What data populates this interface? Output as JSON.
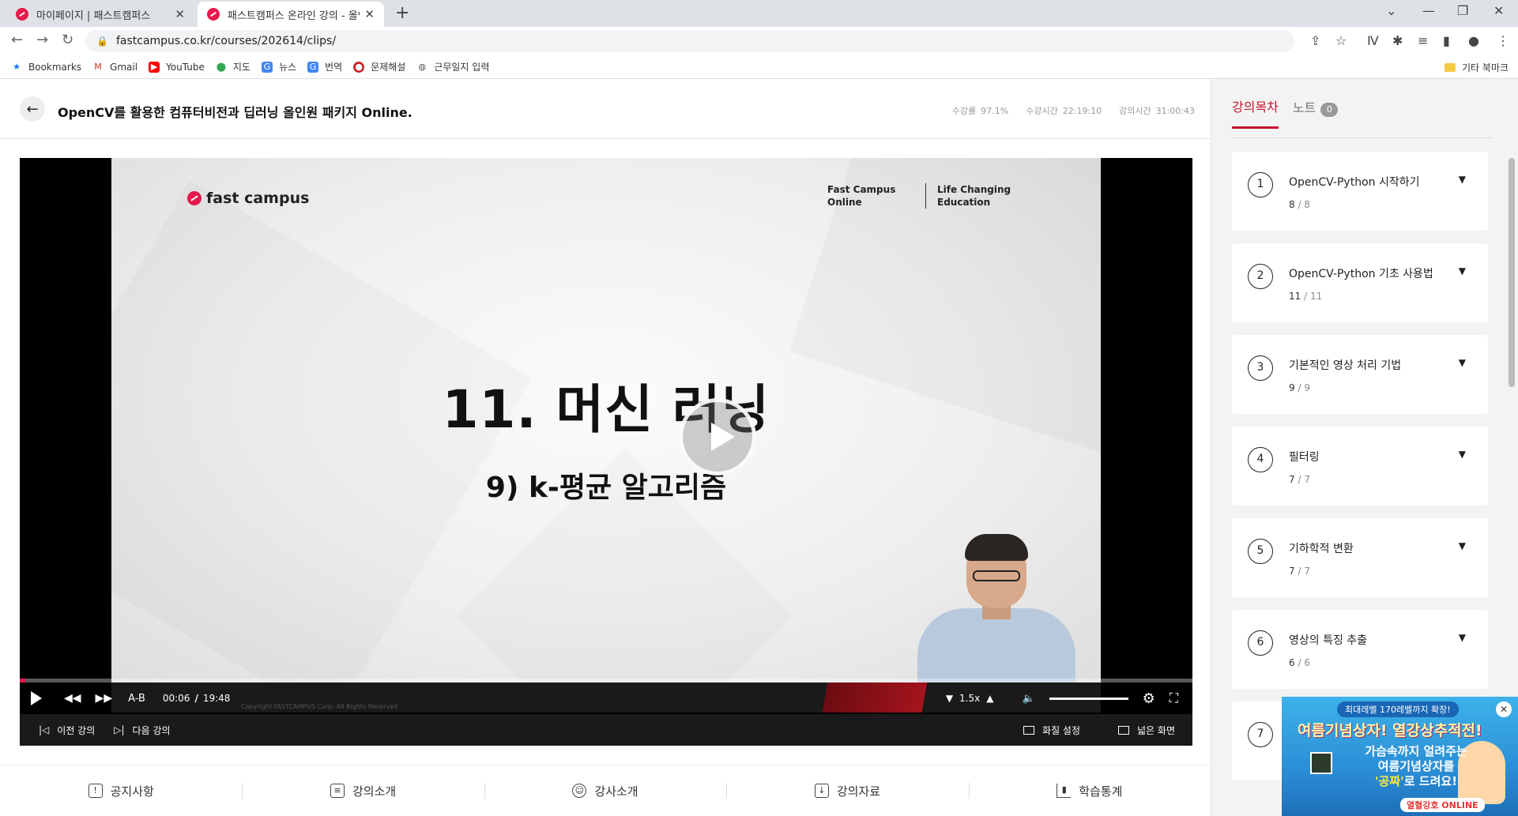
{
  "browser": {
    "tabs": [
      {
        "title": "마이페이지 | 패스트캠퍼스",
        "active": false
      },
      {
        "title": "패스트캠퍼스 온라인 강의 - 올인",
        "active": true
      }
    ],
    "url": "fastcampus.co.kr/courses/202614/clips/",
    "bookmarks": [
      {
        "label": "Bookmarks",
        "icon": "star-icon",
        "color": "#1a73e8"
      },
      {
        "label": "Gmail",
        "icon": "gmail-icon",
        "color": "#d93025"
      },
      {
        "label": "YouTube",
        "icon": "youtube-icon",
        "color": "#ff0000"
      },
      {
        "label": "지도",
        "icon": "maps-icon",
        "color": "#34a853"
      },
      {
        "label": "뉴스",
        "icon": "news-icon",
        "color": "#4285f4"
      },
      {
        "label": "번역",
        "icon": "translate-icon",
        "color": "#4285f4"
      },
      {
        "label": "문제해설",
        "icon": "bookmark-site-icon",
        "color": "#c62828"
      },
      {
        "label": "근무일지 입력",
        "icon": "globe-icon",
        "color": "#555555"
      }
    ],
    "other_bookmarks": "기타 북마크"
  },
  "course": {
    "title": "OpenCV를 활용한 컴퓨터비전과 딥러닝 올인원 패키지 Online.",
    "stats": [
      {
        "label": "수강률",
        "value": "97.1%"
      },
      {
        "label": "수강시간",
        "value": "22:19:10"
      },
      {
        "label": "강의시간",
        "value": "31:00:43"
      }
    ]
  },
  "video": {
    "slide": {
      "brand": "fast campus",
      "tag_a": [
        "Fast Campus",
        "Online"
      ],
      "tag_b": [
        "Life Changing",
        "Education"
      ],
      "title": "11. 머신 러닝",
      "subtitle": "9) k-평균 알고리즘",
      "copyright": "Copyright FASTCAMPUS Corp. All Rights Reserved"
    },
    "progress": 0.005,
    "ab_label": "A-B",
    "current_time": "00:06",
    "separator": "/",
    "duration": "19:48",
    "speed": "1.5x",
    "volume": 1.0,
    "prev_label": "이전 강의",
    "next_label": "다음 강의",
    "quality_label": "화질 설정",
    "wide_label": "넓은 화면"
  },
  "bottom_tabs": [
    {
      "label": "공지사항",
      "icon": "notice-icon"
    },
    {
      "label": "강의소개",
      "icon": "clipboard-icon"
    },
    {
      "label": "강사소개",
      "icon": "user-icon"
    },
    {
      "label": "강의자료",
      "icon": "download-doc-icon"
    },
    {
      "label": "학습통계",
      "icon": "chart-icon"
    }
  ],
  "sidebar": {
    "tab_toc": "강의목차",
    "tab_note": "노트",
    "note_count": "0",
    "chapters": [
      {
        "num": "1",
        "name": "OpenCV-Python 시작하기",
        "done": "8",
        "total": "8"
      },
      {
        "num": "2",
        "name": "OpenCV-Python 기초 사용법",
        "done": "11",
        "total": "11"
      },
      {
        "num": "3",
        "name": "기본적인 영상 처리 기법",
        "done": "9",
        "total": "9"
      },
      {
        "num": "4",
        "name": "필터링",
        "done": "7",
        "total": "7"
      },
      {
        "num": "5",
        "name": "기하학적 변환",
        "done": "7",
        "total": "7"
      },
      {
        "num": "6",
        "name": "영상의 특징 추출",
        "done": "6",
        "total": "6"
      },
      {
        "num": "7",
        "name": "",
        "done": "",
        "total": ""
      }
    ]
  },
  "ad": {
    "badge": "최대레벨 170레벨까지 확장!",
    "headline": "여름기념상자! 열강상추적전!",
    "line1": "가슴속까지 얼려주는",
    "line2": "여름기념상자를",
    "free_word": "'공짜'",
    "line3": "로 드려요!",
    "brand": "열혈강호 ONLINE"
  }
}
